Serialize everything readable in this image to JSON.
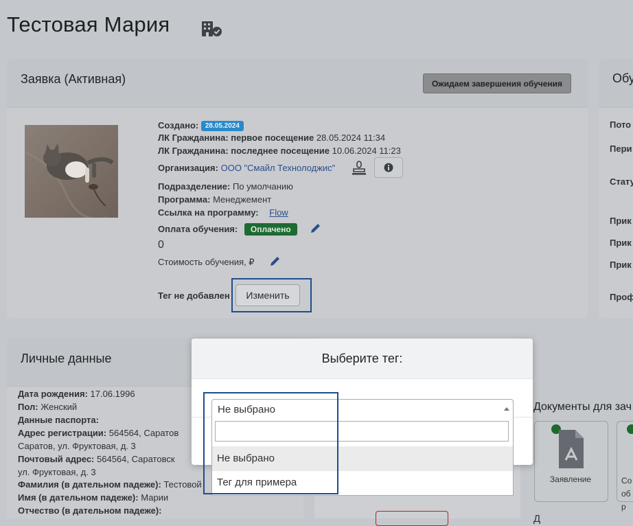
{
  "page": {
    "title": "Тестовая Мария",
    "building_icon": "building-check-icon"
  },
  "application": {
    "title": "Заявка (Активная)",
    "status_button": "Ожидаем завершения обучения",
    "created_label": "Создано:",
    "created_badge": "28.05.2024",
    "first_visit_label": "ЛК Гражданина: первое посещение",
    "first_visit_value": "28.05.2024 11:34",
    "last_visit_label": "ЛК Гражданина: последнее посещение",
    "last_visit_value": "10.06.2024 11:23",
    "org_label": "Организация:",
    "org_value": "ООО \"Смайл Технолоджис\"",
    "stamp_icon": "stamp-icon",
    "info_icon": "info-icon",
    "division_label": "Подразделение:",
    "division_value": "По умолчанию",
    "program_label": "Программа:",
    "program_value": "Менеджемент",
    "program_link_label": "Ссылка на программу:",
    "program_link_value": "Flow",
    "payment_label": "Оплата обучения:",
    "payment_badge": "Оплачено",
    "payment_amount": "0",
    "cost_label": "Стоимость обучения, ₽",
    "tag_label": "Тег не добавлен",
    "change_button": "Изменить"
  },
  "right_card": {
    "title": "Обу",
    "labels": [
      "Пото",
      "Пери",
      "Стату",
      "Прик",
      "Прик",
      "Прик",
      "Проф"
    ]
  },
  "personal": {
    "title": "Личные данные",
    "lines": [
      {
        "label": "Дата рождения:",
        "value": "17.06.1996"
      },
      {
        "label": "Пол:",
        "value": "Женский"
      },
      {
        "label": "Данные паспорта:",
        "value": ""
      },
      {
        "label": "Адрес регистрации:",
        "value": "564564, Саратов"
      },
      {
        "label": "",
        "value": "Саратов, ул. Фруктовая, д. 3"
      },
      {
        "label": "Почтовый адрес:",
        "value": "564564, Саратовск"
      },
      {
        "label": "",
        "value": "ул. Фруктовая, д. 3"
      },
      {
        "label": "Фамилия (в дательном падеже):",
        "value": "Тестовой"
      },
      {
        "label": "Имя (в дательном падеже):",
        "value": "Марии"
      },
      {
        "label": "Отчество (в дательном падеже):",
        "value": ""
      }
    ]
  },
  "documents": {
    "title": "Документы для зач",
    "tiles": [
      {
        "label": "Заявление",
        "icon": "pdf-document-icon"
      },
      {
        "label": "Со обр",
        "icon": ""
      }
    ],
    "bottom_text": "Д"
  },
  "modal": {
    "title": "Выберите тег:",
    "selected": "Не выбрано",
    "search_placeholder": "",
    "options": [
      "Не выбрано",
      "Тег для примера"
    ]
  },
  "colors": {
    "accent_blue": "#1d4c8f",
    "date_badge": "#2a8ac9",
    "paid_badge": "#1e6a33",
    "overlay_bg": "#c4c7cb"
  }
}
